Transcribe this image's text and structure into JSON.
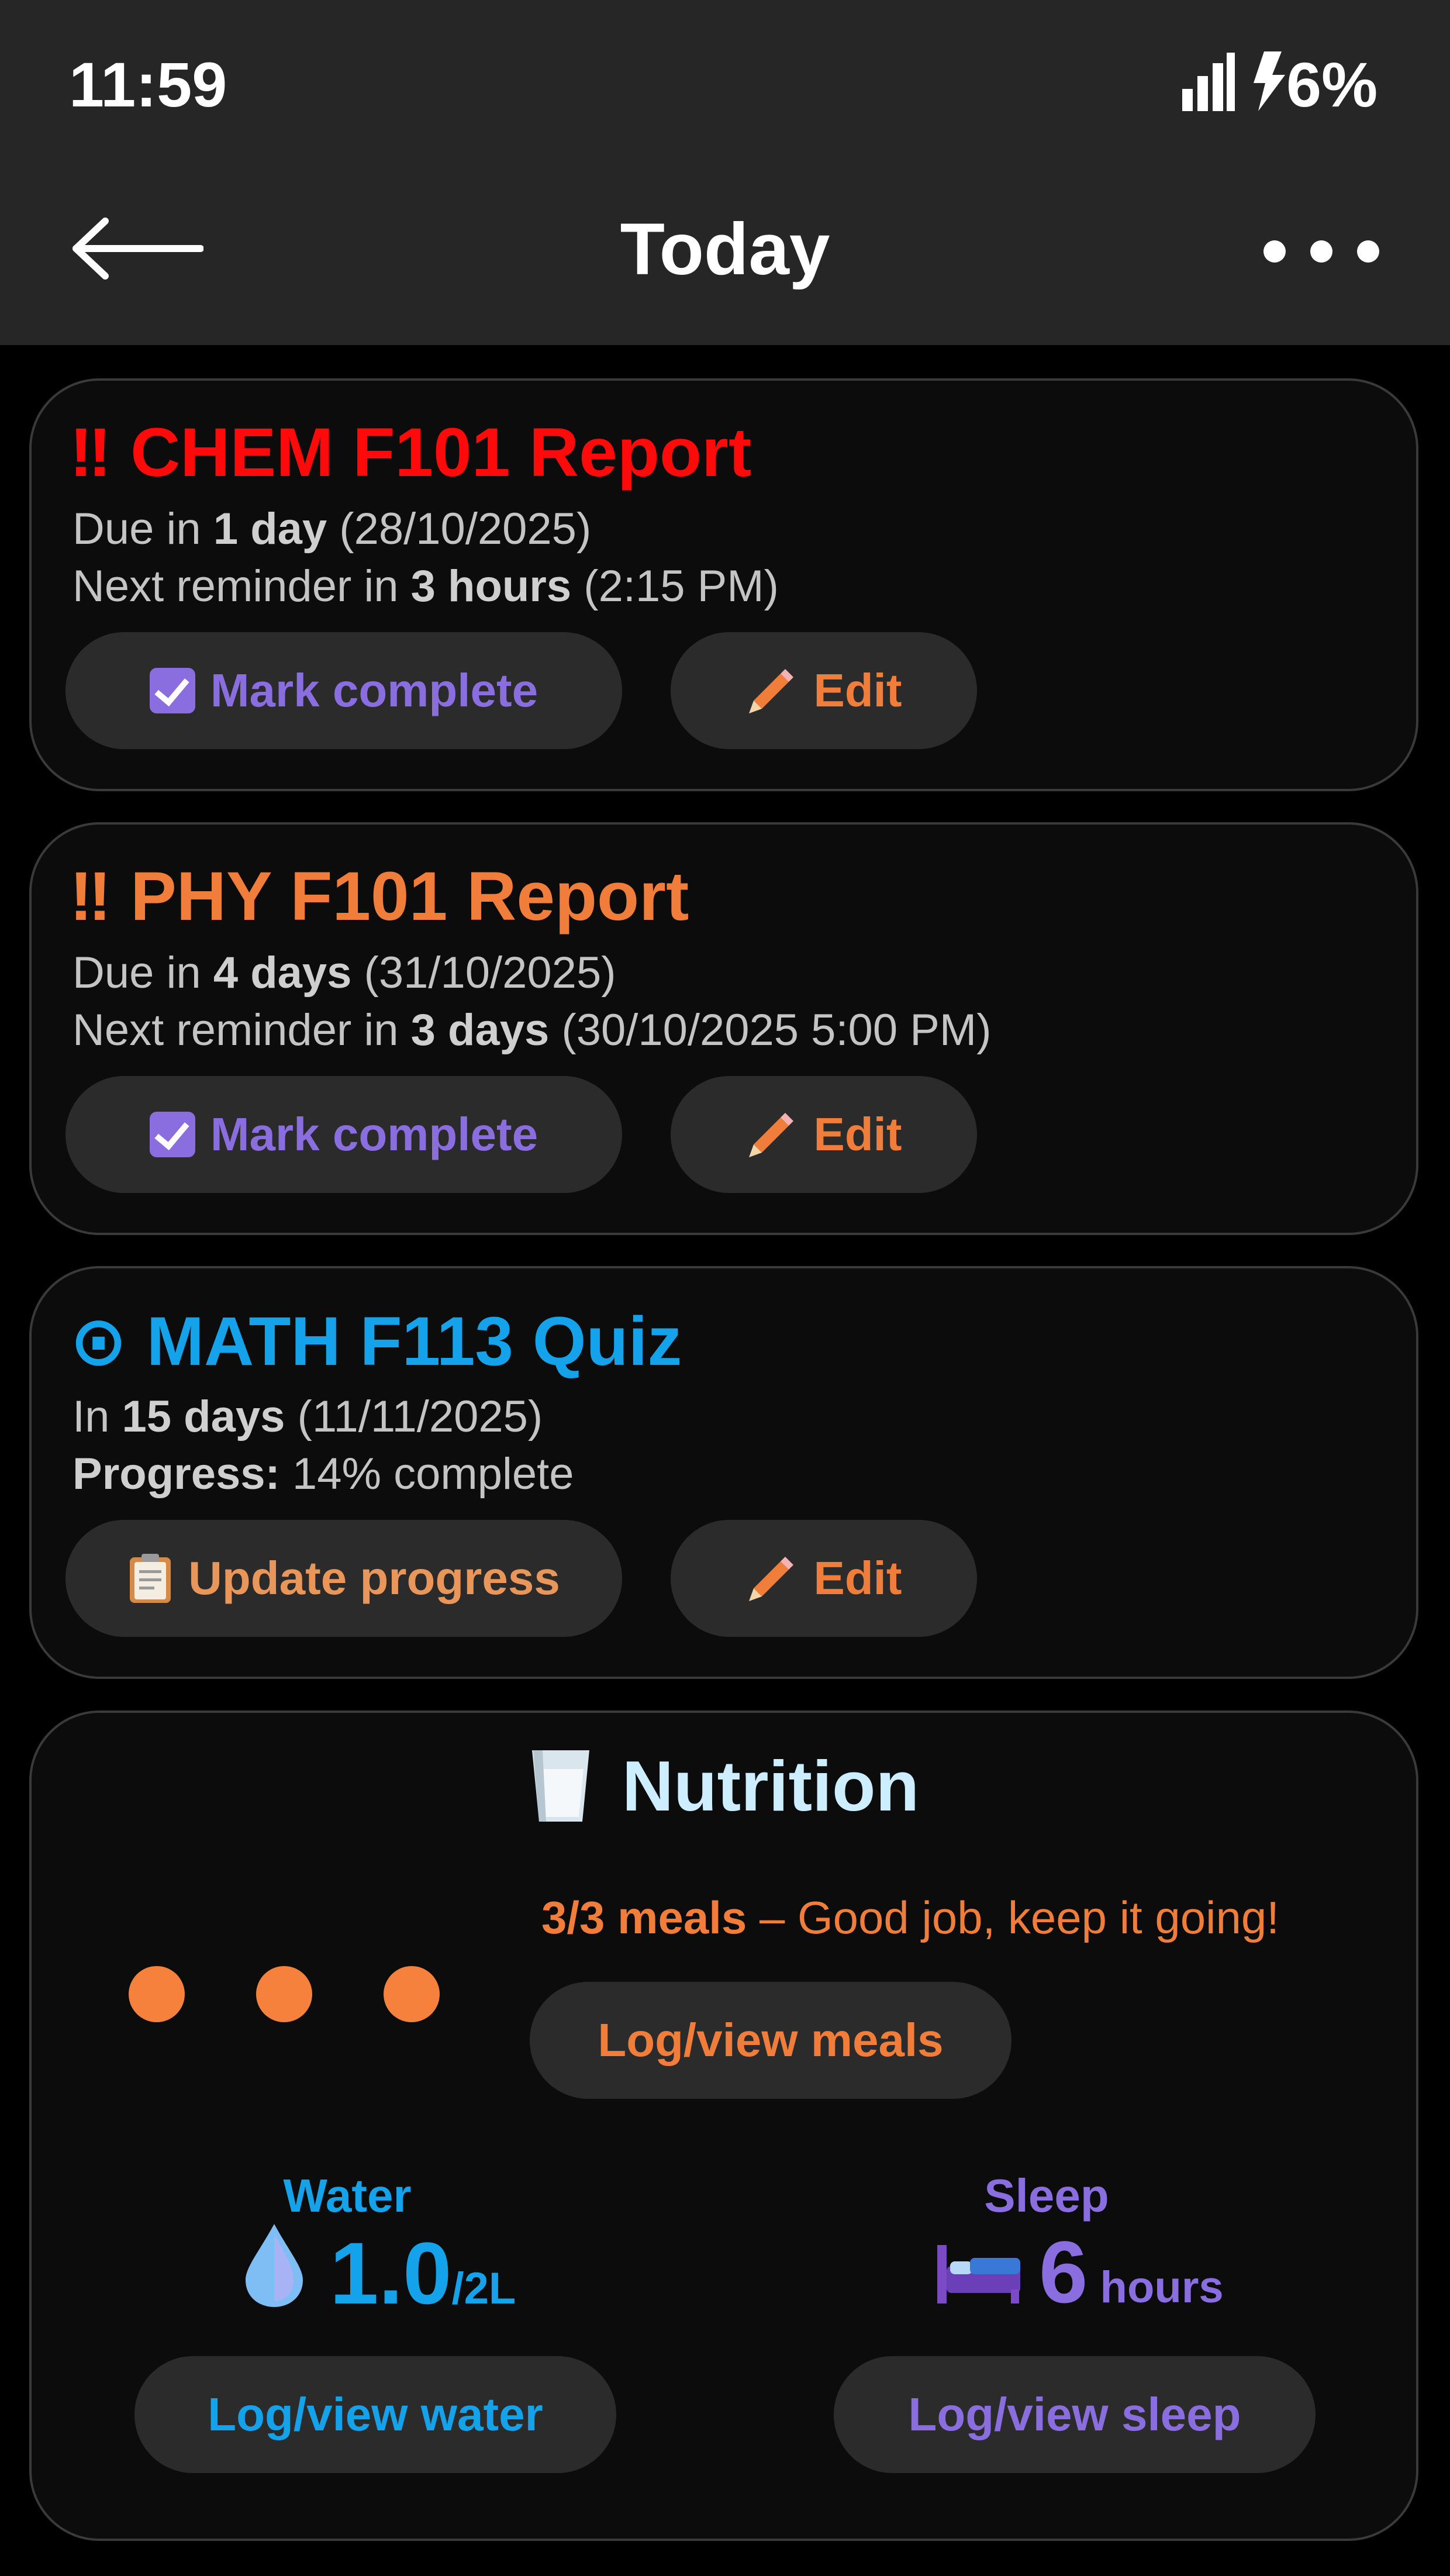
{
  "status_bar": {
    "time": "11:59",
    "battery": "6%"
  },
  "header": {
    "title": "Today"
  },
  "cards": [
    {
      "icon": "‼",
      "title": "CHEM F101 Report",
      "line1": {
        "prefix": "Due in ",
        "bold": "1 day",
        "suffix": " (28/10/2025)"
      },
      "line2": {
        "prefix": "Next reminder in ",
        "bold": "3 hours",
        "suffix": " (2:15 PM)"
      },
      "primary_button": "Mark complete",
      "edit_button": "Edit"
    },
    {
      "icon": "‼",
      "title": "PHY F101 Report",
      "line1": {
        "prefix": "Due in ",
        "bold": "4 days",
        "suffix": " (31/10/2025)"
      },
      "line2": {
        "prefix": "Next reminder in ",
        "bold": "3 days",
        "suffix": " (30/10/2025 5:00 PM)"
      },
      "primary_button": "Mark complete",
      "edit_button": "Edit"
    },
    {
      "icon": "⊙",
      "title": "MATH F113 Quiz",
      "line1": {
        "prefix": "In ",
        "bold": "15 days",
        "suffix": " (11/11/2025)"
      },
      "line2": {
        "prefix": "",
        "bold": "Progress:",
        "suffix": " 14% complete"
      },
      "primary_button": "Update progress",
      "edit_button": "Edit"
    }
  ],
  "nutrition": {
    "title": "Nutrition",
    "meals_count": "3/3 meals",
    "meals_message": " – Good job, keep it going!",
    "meals_button": "Log/view meals",
    "water": {
      "label": "Water",
      "value": "1.0",
      "unit": "/2L",
      "button": "Log/view water"
    },
    "sleep": {
      "label": "Sleep",
      "value": "6",
      "unit": " hours",
      "button": "Log/view sleep"
    }
  },
  "colors": {
    "urgent": "#ff0a0a",
    "warning": "#f07d3a",
    "info": "#14a3ea",
    "purple": "#8a6ddf"
  }
}
